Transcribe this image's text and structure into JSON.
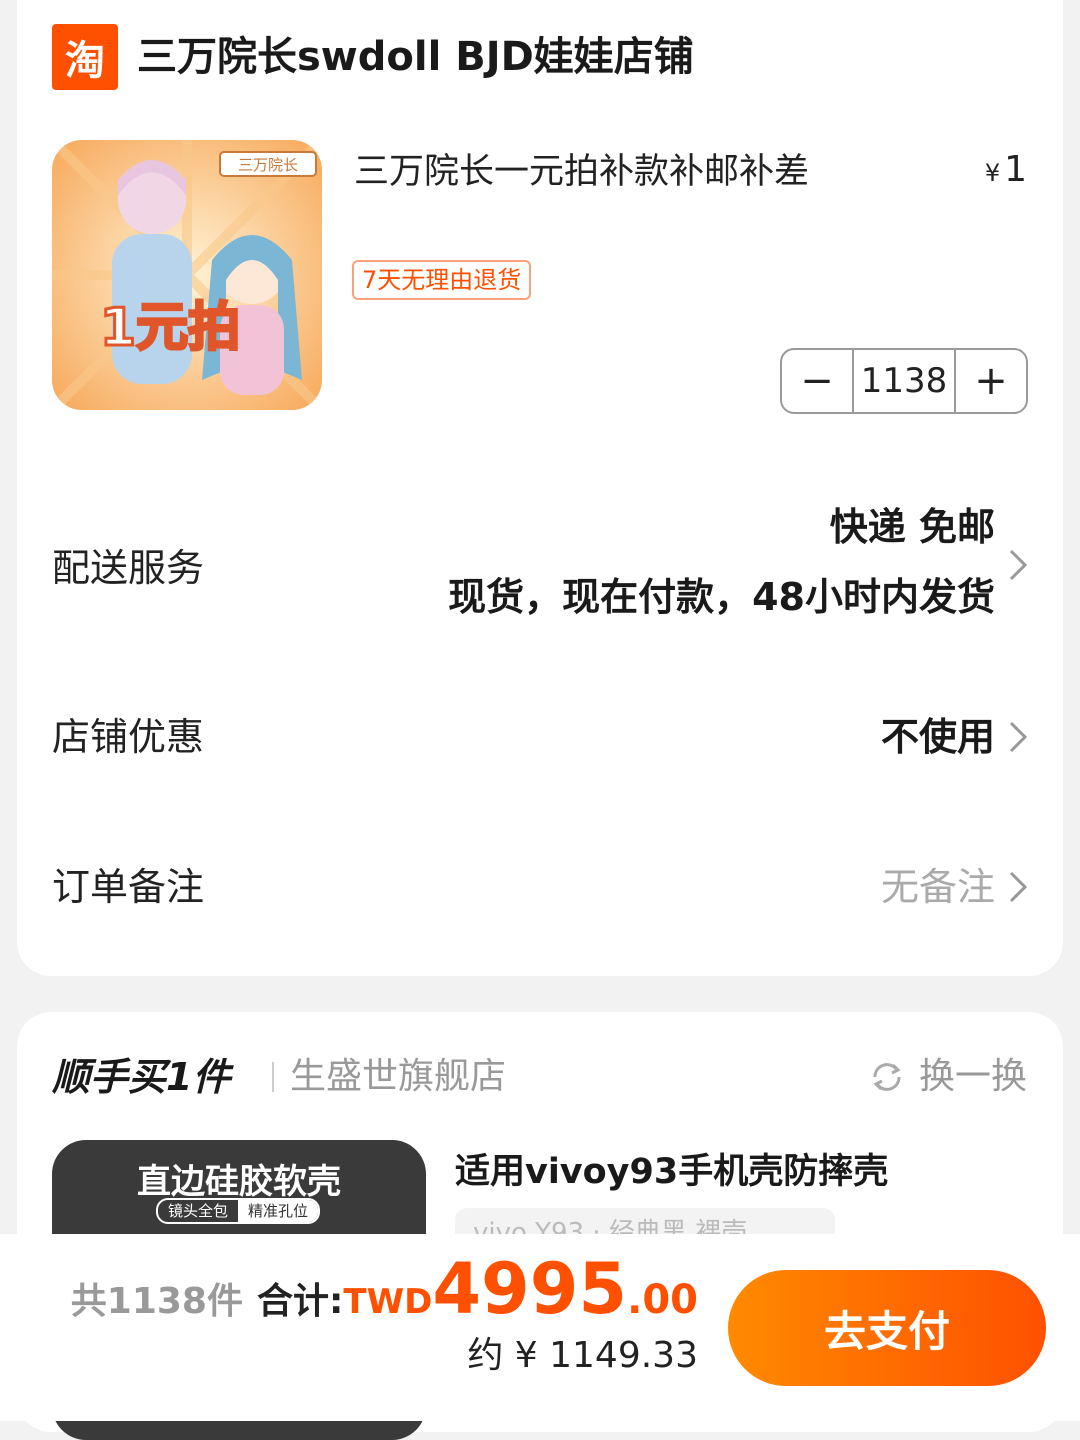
{
  "shop": {
    "logo_char": "淘",
    "name": "三万院长swdoll BJD娃娃店铺"
  },
  "product": {
    "image_caption": "1元拍",
    "image_brand": "三万院长",
    "title": "三万院长一元拍补款补邮补差",
    "price_symbol": "¥",
    "price": "1",
    "return_badge": "7天无理由退货",
    "quantity": "1138",
    "minus_label": "−",
    "plus_label": "+"
  },
  "delivery": {
    "label": "配送服务",
    "line1": "快递 免邮",
    "line2": "现货，现在付款，48小时内发货"
  },
  "coupon": {
    "label": "店铺优惠",
    "value": "不使用"
  },
  "remark": {
    "label": "订单备注",
    "value": "无备注"
  },
  "upsell": {
    "title": "顺手买1件",
    "shop": "生盛世旗舰店",
    "refresh_label": "换一换",
    "image_heading": "直边硅胶软壳",
    "image_tag1": "镜头全包",
    "image_tag2": "精准孔位",
    "product_title": "适用vivoy93手机壳防摔壳",
    "product_sub": "vivo Y93 · 经典黑 裸壳"
  },
  "footer": {
    "count": "共1138件",
    "sum_label": "合计:",
    "currency": "TWD",
    "amount_int": "4995",
    "amount_dec": ".00",
    "approx": "约 ¥ 1149.33",
    "pay_button": "去支付"
  },
  "colors": {
    "accent": "#ff5000",
    "accent_gradient_start": "#ff8a00",
    "background": "#f2f2f2"
  }
}
